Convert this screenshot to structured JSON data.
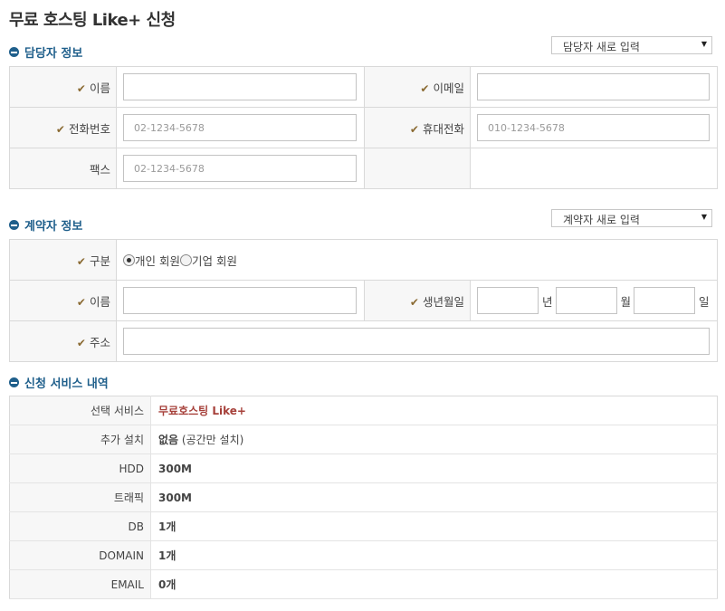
{
  "page": {
    "title": "무료 호스팅 Like+ 신청"
  },
  "contact": {
    "heading": "담당자 정보",
    "select_value": "담당자 새로 입력",
    "name_label": "이름",
    "email_label": "이메일",
    "phone_label": "전화번호",
    "phone_placeholder": "02-1234-5678",
    "mobile_label": "휴대전화",
    "mobile_placeholder": "010-1234-5678",
    "fax_label": "팩스",
    "fax_placeholder": "02-1234-5678"
  },
  "contractor": {
    "heading": "계약자 정보",
    "select_value": "계약자 새로 입력",
    "type_label": "구분",
    "type_options": [
      "개인 회원",
      "기업 회원"
    ],
    "type_selected": "개인 회원",
    "name_label": "이름",
    "birth_label": "생년월일",
    "year_suffix": "년",
    "month_suffix": "월",
    "day_suffix": "일",
    "address_label": "주소"
  },
  "service": {
    "heading": "신청 서비스 내역",
    "rows": [
      {
        "key": "선택 서비스",
        "value": "무료호스팅 Like+"
      },
      {
        "key": "추가 설치",
        "value": "없음",
        "note": " (공간만 설치)"
      },
      {
        "key": "HDD",
        "value": "300M"
      },
      {
        "key": "트래픽",
        "value": "300M"
      },
      {
        "key": "DB",
        "value": "1개"
      },
      {
        "key": "DOMAIN",
        "value": "1개"
      },
      {
        "key": "EMAIL",
        "value": "0개"
      }
    ]
  },
  "colors": {
    "accent_blue": "#1f5f8b",
    "check_brown": "#8a6a32",
    "service_red": "#a6403a"
  }
}
